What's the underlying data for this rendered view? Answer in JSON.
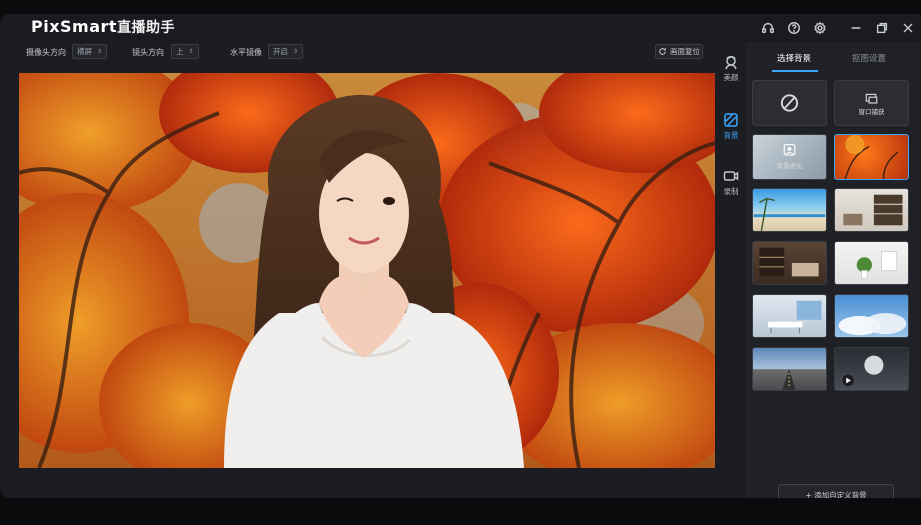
{
  "app": {
    "name_latin": "PixSmart",
    "name_cn": "直播助手"
  },
  "window_controls": {
    "icons": [
      "headset-icon",
      "help-icon",
      "settings-icon",
      "minimize-icon",
      "restore-icon",
      "close-icon"
    ]
  },
  "toolbar": {
    "camera_direction_label": "摄像头方向",
    "camera_direction_value": "横屏",
    "lens_direction_label": "镜头方向",
    "lens_direction_value": "上",
    "mirror_label": "水平镜像",
    "mirror_value": "开启",
    "reset_label": "画面复位"
  },
  "sidenav": {
    "items": [
      {
        "label": "美颜",
        "icon": "face-beauty-icon"
      },
      {
        "label": "背景",
        "icon": "background-icon",
        "active": true
      },
      {
        "label": "录制",
        "icon": "record-icon"
      }
    ]
  },
  "panel": {
    "tabs": [
      {
        "label": "选择背景",
        "active": true
      },
      {
        "label": "抠图设置",
        "active": false
      }
    ],
    "tiles": {
      "none_icon": "none-icon",
      "window_capture_label": "窗口捕获",
      "blur_label": "背景虚化",
      "selected_background": "autumn-maple-trees"
    },
    "add_button_label": "+ 添加自定义背景"
  },
  "colors": {
    "accent": "#3aa7ff",
    "window_bg": "#1c1d22",
    "panel_bg": "#202127"
  }
}
